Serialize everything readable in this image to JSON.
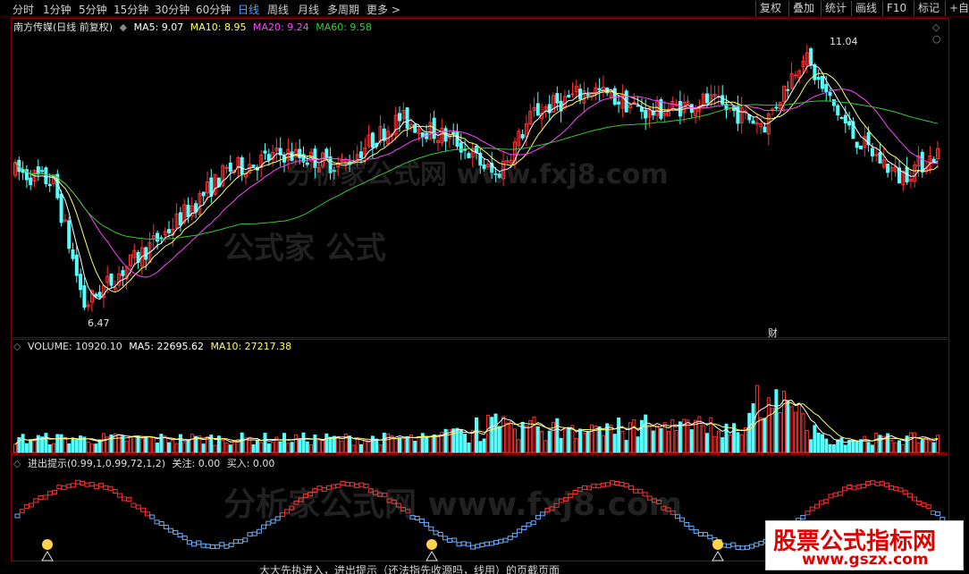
{
  "toolbar": {
    "timeframes": [
      "分时",
      "1分钟",
      "5分钟",
      "15分钟",
      "30分钟",
      "60分钟",
      "日线",
      "周线",
      "月线",
      "多周期",
      "更多 >"
    ],
    "active": "日线",
    "right_buttons": [
      "复权",
      "叠加",
      "统计",
      "画线",
      "F10",
      "标记",
      "+自"
    ]
  },
  "price_panel": {
    "stock": "南方传媒(日线 前复权)",
    "ma5": "MA5: 9.07",
    "ma10": "MA10: 8.95",
    "ma20": "MA20: 9.24",
    "ma60": "MA60: 9.58",
    "high_label": "11.04",
    "low_label": "6.47",
    "cai_label": "财"
  },
  "volume_panel": {
    "volume": "VOLUME: 10920.10",
    "ma5": "MA5: 22695.62",
    "ma10": "MA10: 27217.38"
  },
  "signal_panel": {
    "title": "进出提示(0.99,1,0.99,72,1,2)",
    "focus": "关注: 0.00",
    "buy": "买入: 0.00"
  },
  "bottom_text": "大大先执进入，进出提示（还法指先收源吗，线用）的页截页面",
  "logo": {
    "line1": "股票公式指标网",
    "line2": "www.gszx.com"
  },
  "colors": {
    "ma5": "#ffffff",
    "ma10": "#ffff66",
    "ma20": "#ff44ff",
    "ma60": "#33cc33",
    "up": "#ff3030",
    "down": "#55ffff"
  }
}
